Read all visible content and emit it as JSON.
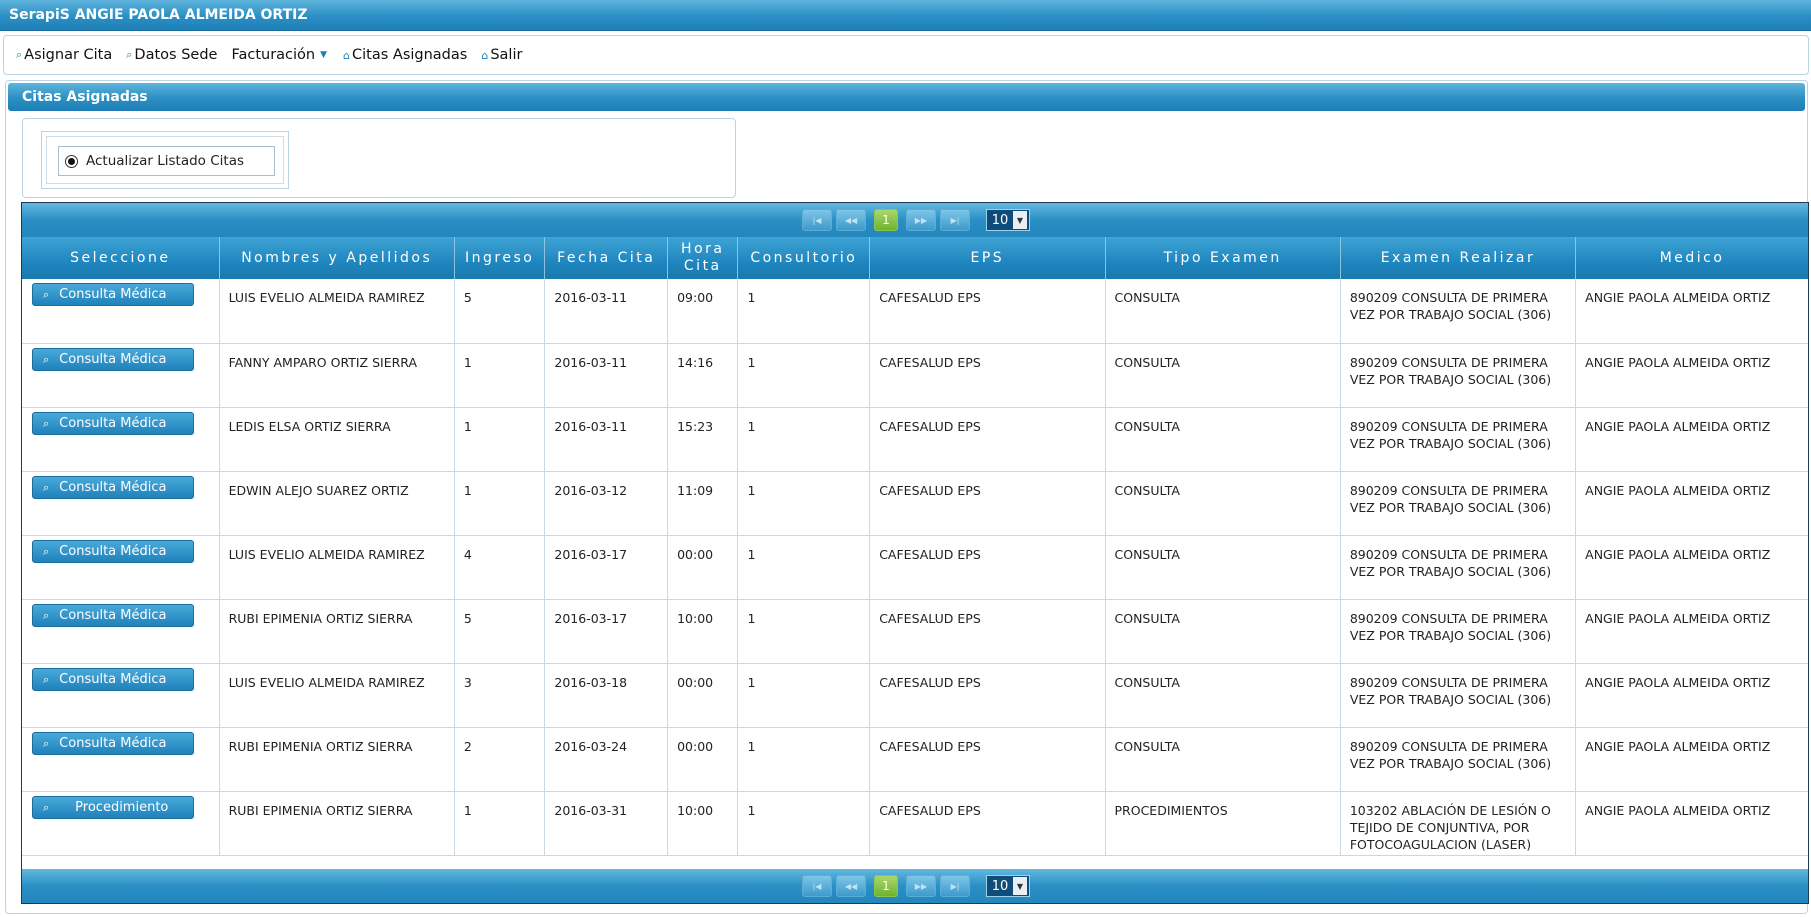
{
  "app": {
    "title": "SerapiS ANGIE PAOLA ALMEIDA ORTIZ"
  },
  "menu": [
    {
      "label": "Asignar Cita",
      "icon": "search-icon"
    },
    {
      "label": "Datos Sede",
      "icon": "search-icon"
    },
    {
      "label": "Facturación",
      "icon": "dropdown-caret-icon"
    },
    {
      "label": "Citas Asignadas",
      "icon": "home-icon"
    },
    {
      "label": "Salir",
      "icon": "home-icon"
    }
  ],
  "panel": {
    "title": "Citas Asignadas"
  },
  "filter": {
    "radio_label": "Actualizar Listado Citas",
    "selected": true
  },
  "pager": {
    "current_page": "1",
    "page_size": "10"
  },
  "columns": {
    "seleccione": "Seleccione",
    "nombres": "Nombres y Apellidos",
    "ingreso": "Ingreso",
    "fecha": "Fecha Cita",
    "hora": "Hora Cita",
    "consultorio": "Consultorio",
    "eps": "EPS",
    "tipo": "Tipo Examen",
    "examen": "Examen Realizar",
    "medico": "Medico"
  },
  "rows": [
    {
      "action": "Consulta Médica",
      "nombre": "LUIS EVELIO ALMEIDA RAMIREZ",
      "ingreso": "5",
      "fecha": "2016-03-11",
      "hora": "09:00",
      "consultorio": "1",
      "eps": "CAFESALUD EPS",
      "tipo": "CONSULTA",
      "examen": "890209 CONSULTA DE PRIMERA VEZ POR TRABAJO SOCIAL (306)",
      "medico": "ANGIE PAOLA ALMEIDA ORTIZ"
    },
    {
      "action": "Consulta Médica",
      "nombre": "FANNY AMPARO ORTIZ SIERRA",
      "ingreso": "1",
      "fecha": "2016-03-11",
      "hora": "14:16",
      "consultorio": "1",
      "eps": "CAFESALUD EPS",
      "tipo": "CONSULTA",
      "examen": "890209 CONSULTA DE PRIMERA VEZ POR TRABAJO SOCIAL (306)",
      "medico": "ANGIE PAOLA ALMEIDA ORTIZ"
    },
    {
      "action": "Consulta Médica",
      "nombre": "LEDIS ELSA ORTIZ SIERRA",
      "ingreso": "1",
      "fecha": "2016-03-11",
      "hora": "15:23",
      "consultorio": "1",
      "eps": "CAFESALUD EPS",
      "tipo": "CONSULTA",
      "examen": "890209 CONSULTA DE PRIMERA VEZ POR TRABAJO SOCIAL (306)",
      "medico": "ANGIE PAOLA ALMEIDA ORTIZ"
    },
    {
      "action": "Consulta Médica",
      "nombre": "EDWIN ALEJO SUAREZ ORTIZ",
      "ingreso": "1",
      "fecha": "2016-03-12",
      "hora": "11:09",
      "consultorio": "1",
      "eps": "CAFESALUD EPS",
      "tipo": "CONSULTA",
      "examen": "890209 CONSULTA DE PRIMERA VEZ POR TRABAJO SOCIAL (306)",
      "medico": "ANGIE PAOLA ALMEIDA ORTIZ"
    },
    {
      "action": "Consulta Médica",
      "nombre": "LUIS EVELIO ALMEIDA RAMIREZ",
      "ingreso": "4",
      "fecha": "2016-03-17",
      "hora": "00:00",
      "consultorio": "1",
      "eps": "CAFESALUD EPS",
      "tipo": "CONSULTA",
      "examen": "890209 CONSULTA DE PRIMERA VEZ POR TRABAJO SOCIAL (306)",
      "medico": "ANGIE PAOLA ALMEIDA ORTIZ"
    },
    {
      "action": "Consulta Médica",
      "nombre": "RUBI EPIMENIA ORTIZ SIERRA",
      "ingreso": "5",
      "fecha": "2016-03-17",
      "hora": "10:00",
      "consultorio": "1",
      "eps": "CAFESALUD EPS",
      "tipo": "CONSULTA",
      "examen": "890209 CONSULTA DE PRIMERA VEZ POR TRABAJO SOCIAL (306)",
      "medico": "ANGIE PAOLA ALMEIDA ORTIZ"
    },
    {
      "action": "Consulta Médica",
      "nombre": "LUIS EVELIO ALMEIDA RAMIREZ",
      "ingreso": "3",
      "fecha": "2016-03-18",
      "hora": "00:00",
      "consultorio": "1",
      "eps": "CAFESALUD EPS",
      "tipo": "CONSULTA",
      "examen": "890209 CONSULTA DE PRIMERA VEZ POR TRABAJO SOCIAL (306)",
      "medico": "ANGIE PAOLA ALMEIDA ORTIZ"
    },
    {
      "action": "Consulta Médica",
      "nombre": "RUBI EPIMENIA ORTIZ SIERRA",
      "ingreso": "2",
      "fecha": "2016-03-24",
      "hora": "00:00",
      "consultorio": "1",
      "eps": "CAFESALUD EPS",
      "tipo": "CONSULTA",
      "examen": "890209 CONSULTA DE PRIMERA VEZ POR TRABAJO SOCIAL (306)",
      "medico": "ANGIE PAOLA ALMEIDA ORTIZ"
    },
    {
      "action": "Procedimiento",
      "nombre": "RUBI EPIMENIA ORTIZ SIERRA",
      "ingreso": "1",
      "fecha": "2016-03-31",
      "hora": "10:00",
      "consultorio": "1",
      "eps": "CAFESALUD EPS",
      "tipo": "PROCEDIMIENTOS",
      "examen": "103202 ABLACIÓN DE LESIÓN O TEJIDO DE CONJUNTIVA, POR FOTOCOAGULACION (LASER)",
      "medico": "ANGIE PAOLA ALMEIDA ORTIZ"
    }
  ]
}
